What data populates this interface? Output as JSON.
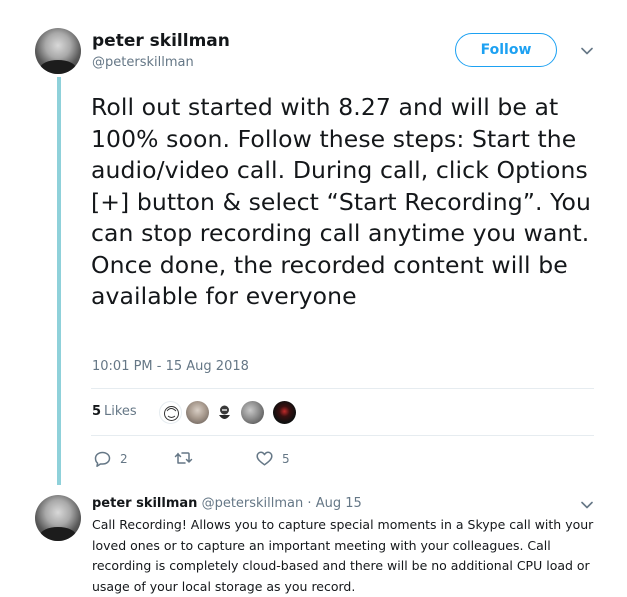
{
  "tweet": {
    "author": {
      "name": "peter skillman",
      "handle": "@peterskillman"
    },
    "follow_label": "Follow",
    "text": "Roll out started with 8.27 and will be at 100% soon. Follow these steps: Start the audio/video call. During call, click Options [+] button & select “Start Recording”. You can stop recording call anytime you want. Once done, the recorded content will be available for everyone",
    "timestamp": "10:01 PM - 15 Aug 2018",
    "likes": {
      "count": "5",
      "label": "Likes"
    },
    "actions": {
      "reply_count": "2",
      "like_count": "5"
    }
  },
  "reply": {
    "author": {
      "name": "peter skillman",
      "handle": "@peterskillman"
    },
    "separator": "·",
    "date": "Aug 15",
    "text": "Call Recording!  Allows you to capture special moments in a Skype call with your loved ones or to capture an important meeting with your colleagues.  Call recording is completely cloud-based and there will be no additional CPU load or usage of your local storage as you record."
  },
  "colors": {
    "accent": "#1da1f2",
    "thread_line": "#8fd1da",
    "muted": "#657786",
    "text": "#14171a"
  }
}
